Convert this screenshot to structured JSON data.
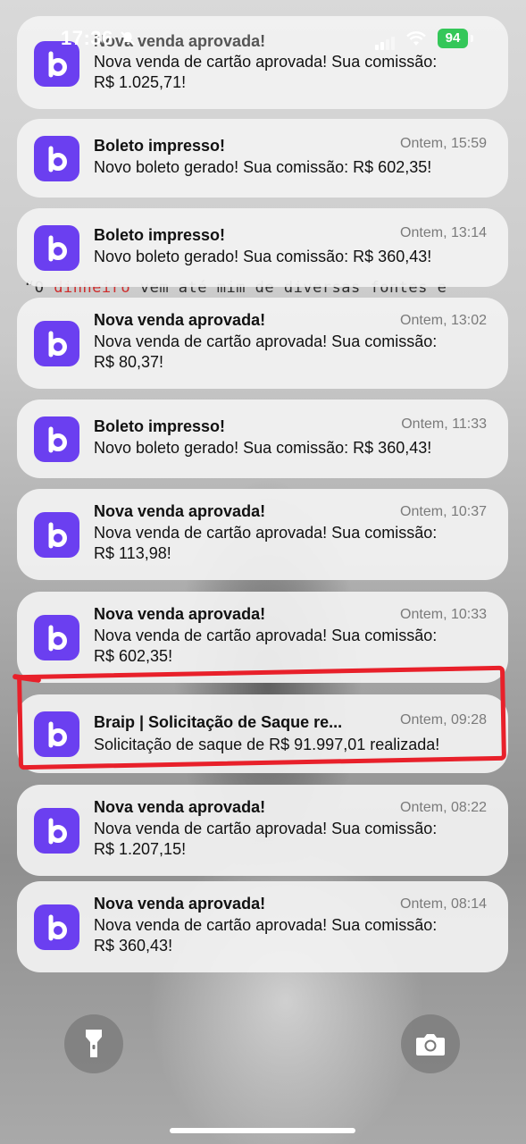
{
  "status_bar": {
    "time": "17:36",
    "battery": "94"
  },
  "background_quote": {
    "prefix": "“O ",
    "highlight": "dinheiro",
    "suffix": " vem até mim de diversas fontes e"
  },
  "notifications": [
    {
      "title": "Nova venda aprovada!",
      "time": "",
      "body": "Nova venda de cartão aprovada! Sua comissão:\nR$ 1.025,71!"
    },
    {
      "title": "Boleto impresso!",
      "time": "Ontem, 15:59",
      "body": "Novo boleto gerado! Sua comissão: R$ 602,35!"
    },
    {
      "title": "Boleto impresso!",
      "time": "Ontem, 13:14",
      "body": "Novo boleto gerado! Sua comissão: R$ 360,43!"
    },
    {
      "title": "Nova venda aprovada!",
      "time": "Ontem, 13:02",
      "body": "Nova venda de cartão aprovada! Sua comissão:\nR$ 80,37!"
    },
    {
      "title": "Boleto impresso!",
      "time": "Ontem, 11:33",
      "body": "Novo boleto gerado! Sua comissão: R$ 360,43!"
    },
    {
      "title": "Nova venda aprovada!",
      "time": "Ontem, 10:37",
      "body": "Nova venda de cartão aprovada! Sua comissão:\nR$ 113,98!"
    },
    {
      "title": "Nova venda aprovada!",
      "time": "Ontem, 10:33",
      "body": "Nova venda de cartão aprovada! Sua comissão:\nR$ 602,35!"
    },
    {
      "title": "Braip | Solicitação de Saque re...",
      "time": "Ontem, 09:28",
      "body": "Solicitação de saque de R$ 91.997,01 realizada!"
    },
    {
      "title": "Nova venda aprovada!",
      "time": "Ontem, 08:22",
      "body": "Nova venda de cartão aprovada! Sua comissão:\nR$ 1.207,15!"
    },
    {
      "title": "Nova venda aprovada!",
      "time": "Ontem, 08:14",
      "body": "Nova venda de cartão aprovada! Sua comissão:\nR$ 360,43!"
    }
  ],
  "colors": {
    "app_icon": "#6b3ff0",
    "highlight_ring": "#e8202a",
    "battery": "#34c759"
  },
  "icons": {
    "app": "braip-b-logo-icon",
    "flashlight": "flashlight-icon",
    "camera": "camera-icon"
  }
}
